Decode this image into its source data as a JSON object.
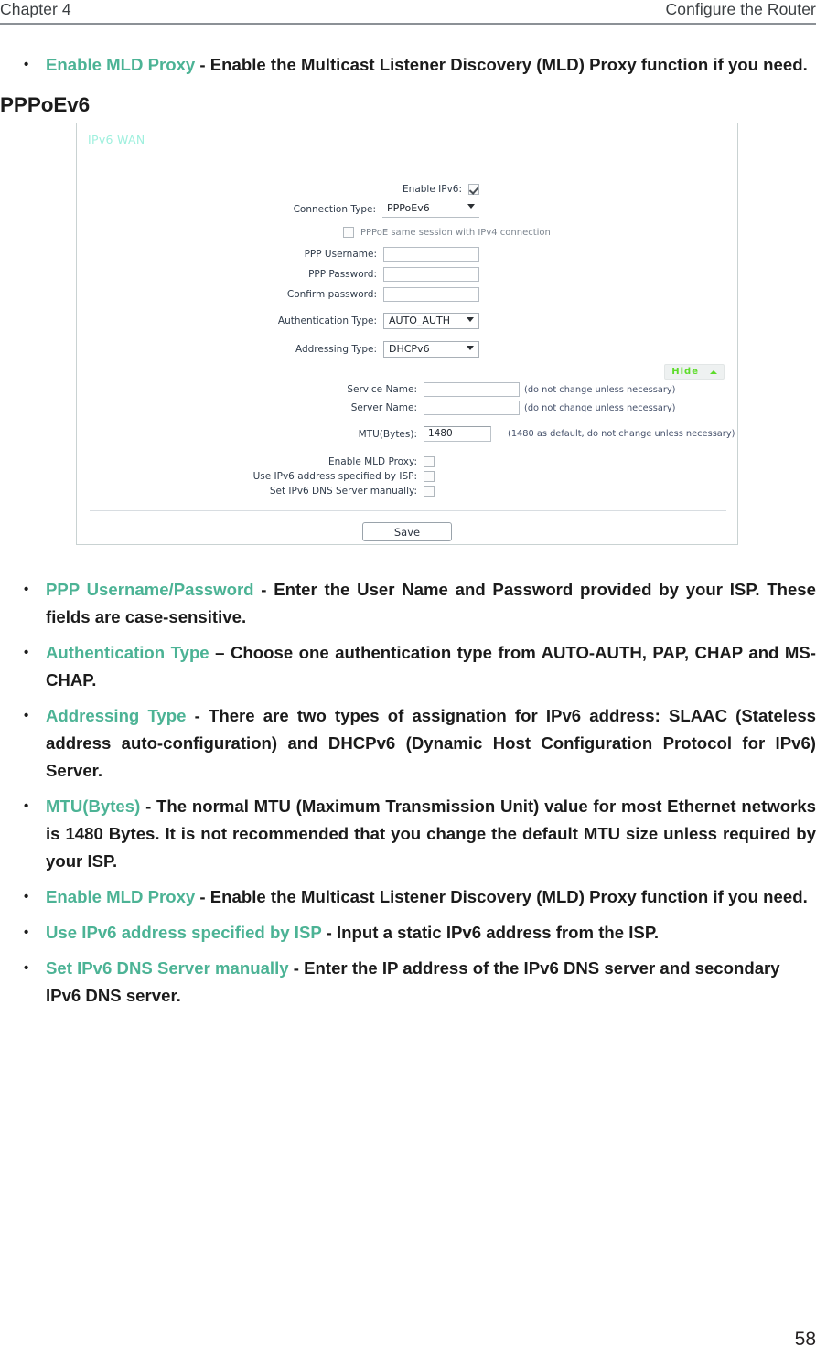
{
  "header": {
    "left": "Chapter 4",
    "right": "Configure the Router"
  },
  "top_bullet": {
    "term": "Enable MLD Proxy",
    "text": " - Enable the Multicast Listener Discovery (MLD) Proxy function if you need."
  },
  "section_heading": "PPPoEv6",
  "screenshot": {
    "panel_title": "IPv6 WAN",
    "fields": {
      "enable_ipv6_label": "Enable IPv6:",
      "connection_type_label": "Connection Type:",
      "connection_type_value": "PPPoEv6",
      "same_session_label": "PPPoE same session with IPv4 connection",
      "ppp_username_label": "PPP Username:",
      "ppp_username_value": "",
      "ppp_password_label": "PPP Password:",
      "ppp_password_value": "",
      "confirm_password_label": "Confirm password:",
      "confirm_password_value": "",
      "auth_type_label": "Authentication Type:",
      "auth_type_value": "AUTO_AUTH",
      "addressing_type_label": "Addressing Type:",
      "addressing_type_value": "DHCPv6",
      "service_name_label": "Service Name:",
      "service_name_value": "",
      "service_name_hint": "(do not change unless necessary)",
      "server_name_label": "Server Name:",
      "server_name_value": "",
      "server_name_hint": "(do not change unless necessary)",
      "mtu_label": "MTU(Bytes):",
      "mtu_value": "1480",
      "mtu_hint": "(1480 as default, do not change unless necessary)",
      "enable_mld_proxy_label": "Enable MLD Proxy:",
      "use_ipv6_isp_label": "Use IPv6 address specified by ISP:",
      "set_ipv6_dns_label": "Set IPv6 DNS Server manually:",
      "hide_button": "Hide",
      "save_button": "Save"
    }
  },
  "bullets": [
    {
      "term": "PPP Username/Password",
      "text": " - Enter the User Name and Password provided by your ISP. These fields are case-sensitive."
    },
    {
      "term": "Authentication Type",
      "text": " – Choose one authentication type from AUTO-AUTH, PAP, CHAP and MS-CHAP."
    },
    {
      "term": "Addressing Type",
      "text": " - There are two types of assignation for IPv6 address: SLAAC (Stateless address auto-configuration) and DHCPv6 (Dynamic Host Configuration Protocol for IPv6) Server."
    },
    {
      "term": "MTU(Bytes)",
      "text": " - The normal MTU (Maximum Transmission Unit) value for most Ethernet networks is 1480 Bytes. It is not recommended that you change the default MTU size unless required by your ISP."
    },
    {
      "term": "Enable MLD Proxy",
      "text": " - Enable the Multicast Listener Discovery (MLD) Proxy function if you need."
    },
    {
      "term": "Use IPv6 address specified by ISP",
      "text": " - Input a static IPv6 address from the ISP."
    },
    {
      "term": "Set IPv6 DNS Server manually",
      "text": " - Enter the IP address of the IPv6 DNS server and secondary IPv6 DNS server."
    }
  ],
  "footer": {
    "page_number": "58"
  },
  "colors": {
    "term_accent": "#4cb395",
    "panel_title": "#9ff0de",
    "hide_green": "#5ddc2a"
  }
}
